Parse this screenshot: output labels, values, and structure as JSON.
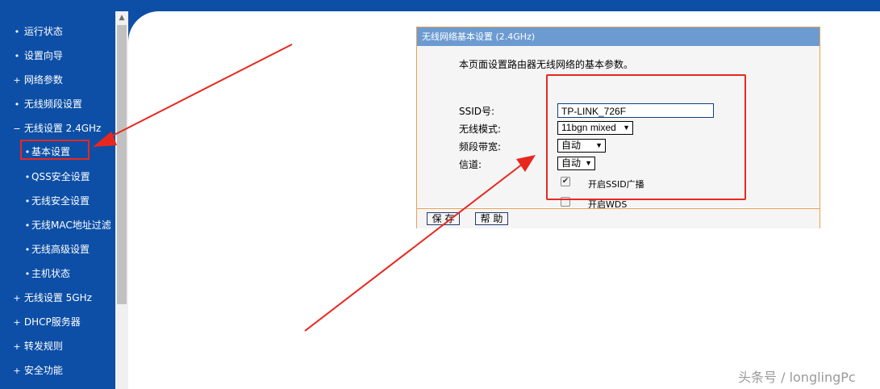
{
  "sidebar": {
    "items": [
      {
        "bullet": "•",
        "label": "运行状态"
      },
      {
        "bullet": "•",
        "label": "设置向导"
      },
      {
        "bullet": "+",
        "label": "网络参数"
      },
      {
        "bullet": "•",
        "label": "无线频段设置"
      },
      {
        "bullet": "−",
        "label": "无线设置 2.4GHz"
      },
      {
        "bullet": "•",
        "label": "基本设置"
      },
      {
        "bullet": "•",
        "label": "QSS安全设置"
      },
      {
        "bullet": "•",
        "label": "无线安全设置"
      },
      {
        "bullet": "•",
        "label": "无线MAC地址过滤"
      },
      {
        "bullet": "•",
        "label": "无线高级设置"
      },
      {
        "bullet": "•",
        "label": "主机状态"
      },
      {
        "bullet": "+",
        "label": "无线设置 5GHz"
      },
      {
        "bullet": "+",
        "label": "DHCP服务器"
      },
      {
        "bullet": "+",
        "label": "转发规则"
      },
      {
        "bullet": "+",
        "label": "安全功能"
      }
    ]
  },
  "panel": {
    "title": "无线网络基本设置 (2.4GHz)",
    "description": "本页面设置路由器无线网络的基本参数。",
    "ssid_label": "SSID号:",
    "ssid_value": "TP-LINK_726F",
    "mode_label": "无线模式:",
    "mode_value": "11bgn mixed",
    "bandwidth_label": "频段带宽:",
    "bandwidth_value": "自动",
    "channel_label": "信道:",
    "channel_value": "自动",
    "ssid_broadcast_label": "开启SSID广播",
    "ssid_broadcast_checked": true,
    "wds_label": "开启WDS",
    "wds_checked": false,
    "save_label": "保 存",
    "help_label": "帮 助"
  },
  "icons": {
    "dropdown": "▼",
    "check": "✔",
    "scroll_up": "▲"
  },
  "colors": {
    "sidebar": "#0d4fa6",
    "header": "#6c9bd2",
    "panel_border": "#e6a156",
    "annotation": "#e8281f"
  },
  "watermark": "头条号 / longlingPc"
}
